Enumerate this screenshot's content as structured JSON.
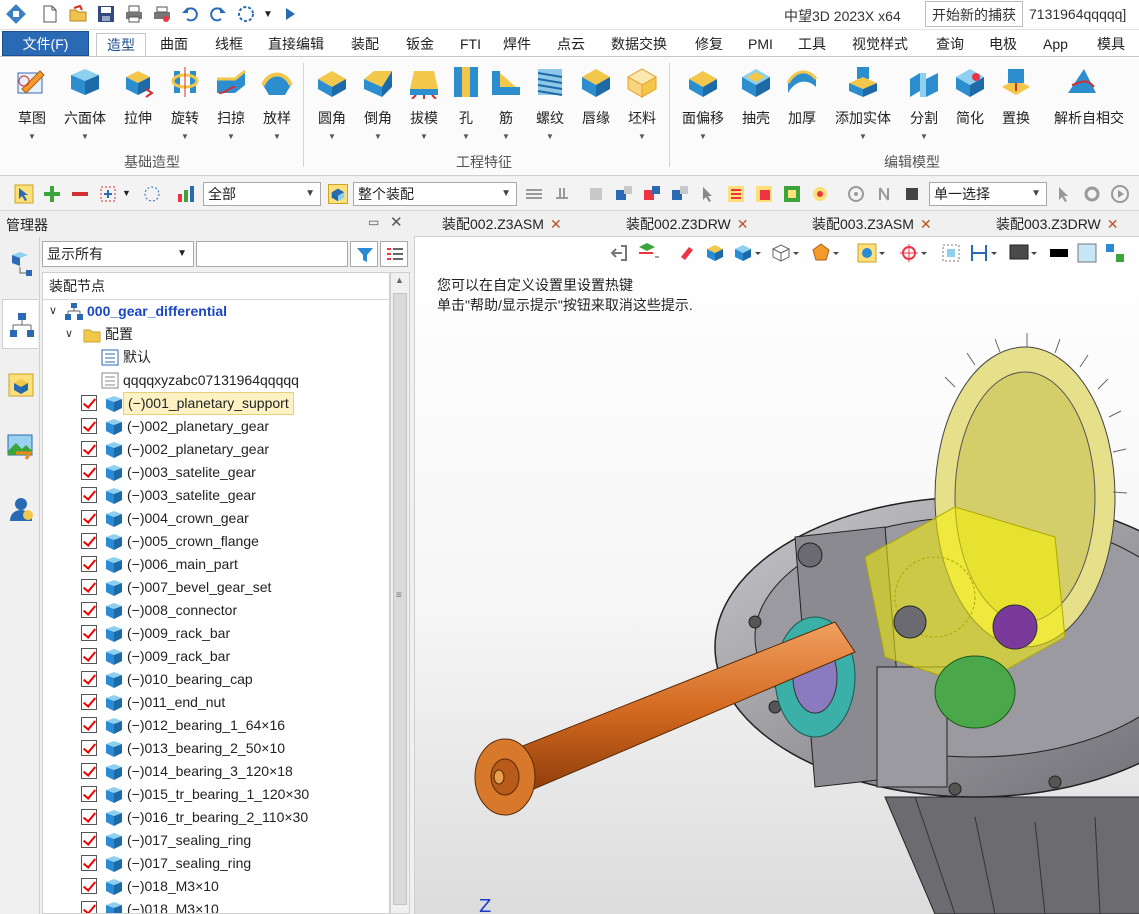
{
  "titlebar": {
    "app_title": "中望3D 2023X x64",
    "tooltip": "开始新的捕获",
    "title_tail": "7131964qqqqq]"
  },
  "ribbon_tabs": [
    "文件(F)",
    "造型",
    "曲面",
    "线框",
    "直接编辑",
    "装配",
    "钣金",
    "FTI",
    "焊件",
    "点云",
    "数据交换",
    "修复",
    "PMI",
    "工具",
    "视觉样式",
    "查询",
    "电极",
    "App",
    "模具"
  ],
  "ribbon": {
    "groups": [
      {
        "label": "基础造型",
        "buttons": [
          "草图",
          "六面体",
          "拉伸",
          "旋转",
          "扫掠",
          "放样"
        ]
      },
      {
        "label": "工程特征",
        "buttons": [
          "圆角",
          "倒角",
          "拔模",
          "孔",
          "筋",
          "螺纹",
          "唇缘",
          "坯料"
        ]
      },
      {
        "label": "编辑模型",
        "buttons": [
          "面偏移",
          "抽壳",
          "加厚",
          "添加实体",
          "分割",
          "简化",
          "置换",
          "解析自相交"
        ]
      }
    ]
  },
  "toolbar": {
    "filter_value": "全部",
    "scope_value": "整个装配",
    "select_mode": "单一选择"
  },
  "manager": {
    "title": "管理器",
    "filter_value": "显示所有",
    "search_value": "",
    "tree_header": "装配节点",
    "root": "000_gear_differential",
    "config_folder": "配置",
    "configs": [
      "默认",
      "qqqqxyzabc07131964qqqqq"
    ],
    "parts": [
      "(−)001_planetary_support",
      "(−)002_planetary_gear",
      "(−)002_planetary_gear",
      "(−)003_satelite_gear",
      "(−)003_satelite_gear",
      "(−)004_crown_gear",
      "(−)005_crown_flange",
      "(−)006_main_part",
      "(−)007_bevel_gear_set",
      "(−)008_connector",
      "(−)009_rack_bar",
      "(−)009_rack_bar",
      "(−)010_bearing_cap",
      "(−)011_end_nut",
      "(−)012_bearing_1_64×16",
      "(−)013_bearing_2_50×10",
      "(−)014_bearing_3_120×18",
      "(−)015_tr_bearing_1_120×30",
      "(−)016_tr_bearing_2_110×30",
      "(−)017_sealing_ring",
      "(−)017_sealing_ring",
      "(−)018_M3×10",
      "(−)018_M3×10"
    ],
    "highlighted_index": 0
  },
  "doc_tabs": [
    "装配002.Z3ASM",
    "装配002.Z3DRW",
    "装配003.Z3ASM",
    "装配003.Z3DRW"
  ],
  "viewport": {
    "hint_line1": "您可以在自定义设置里设置热键",
    "hint_line2": "单击\"帮助/显示提示\"按钮来取消这些提示.",
    "axis_label": "Z"
  }
}
